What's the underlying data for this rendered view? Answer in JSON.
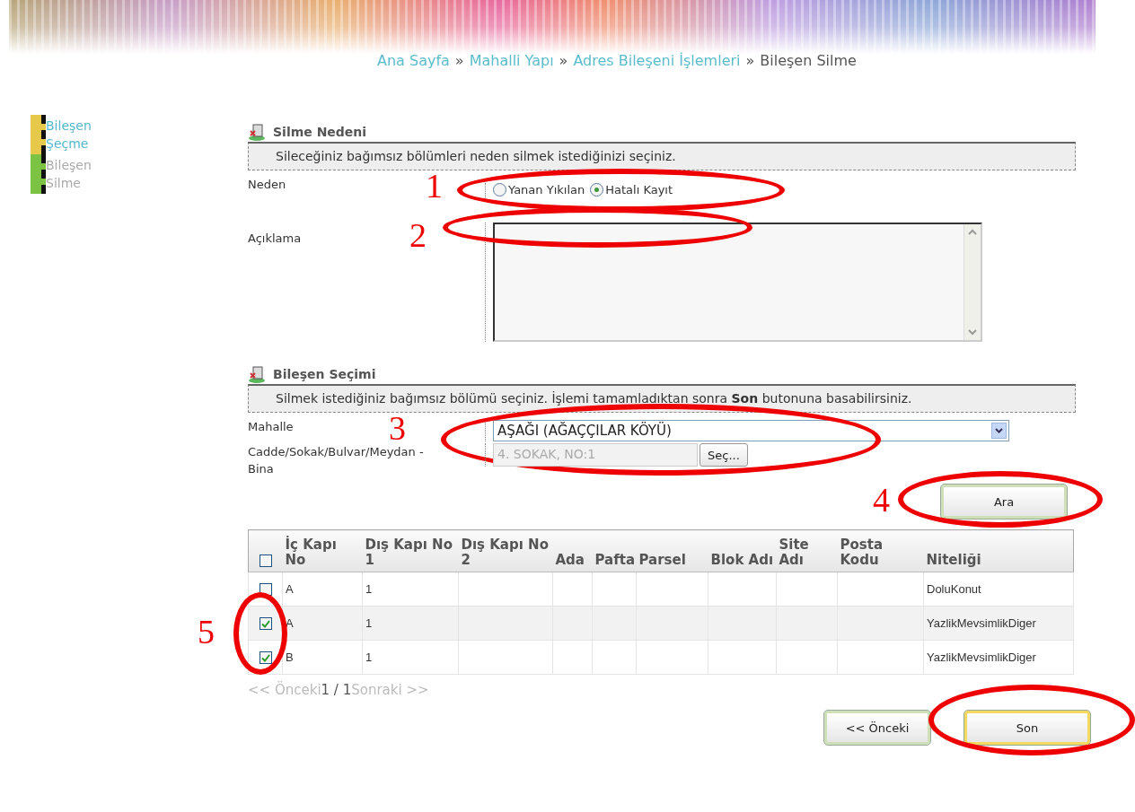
{
  "breadcrumb": [
    {
      "label": "Ana Sayfa",
      "link": true
    },
    {
      "label": "»",
      "link": false
    },
    {
      "label": "Mahalli Yapı",
      "link": true
    },
    {
      "label": "»",
      "link": false
    },
    {
      "label": "Adres Bileşeni İşlemleri",
      "link": true
    },
    {
      "label": "»",
      "link": false
    },
    {
      "label": "Bileşen Silme",
      "link": false
    }
  ],
  "steps": [
    {
      "label": "Bileşen Şeçme",
      "active": true,
      "color": "#e6c84a"
    },
    {
      "label": "Bileşen Silme",
      "active": false,
      "color": "#7cc243"
    }
  ],
  "reason_section": {
    "title": "Silme Nedeni",
    "info": "Sileceğiniz bağımsız bölümleri neden silmek istediğinizi seçiniz.",
    "reason": {
      "label": "Neden",
      "annotation": "1",
      "options": [
        {
          "label": "Yanan Yıkılan",
          "selected": false
        },
        {
          "label": "Hatalı Kayıt",
          "selected": true
        }
      ]
    },
    "description": {
      "label": "Açıklama",
      "annotation": "2"
    }
  },
  "selection_section": {
    "title": "Bileşen Seçimi",
    "info": "Silmek istediğiniz bağımsız bölümü seçiniz. İşlemi tamamladıktan sonra **Son** butonuna basabilirsiniz.",
    "neighborhood": {
      "label": "Mahalle",
      "value": "AŞAĞI (AĞAÇÇILAR KÖYÜ)",
      "annotation": "3"
    },
    "street": {
      "label": "Cadde/Sokak/Bulvar/Meydan - Bina",
      "value": "4. SOKAK, NO:1",
      "disabled": true,
      "button": "Seç..."
    },
    "search_button": {
      "label": "Ara",
      "annotation": "4"
    }
  },
  "table": {
    "select_all": false,
    "annotation": "5",
    "columns": [
      "İç Kapı No",
      "Dış Kapı No 1",
      "Dış Kapı No 2",
      "Ada",
      "Pafta",
      "Parsel",
      "Blok Adı",
      "Site Adı",
      "Posta Kodu",
      "Niteliği"
    ],
    "rows": [
      {
        "checked": false,
        "cells": [
          "A",
          "1",
          "",
          "",
          "",
          "",
          "",
          "",
          "",
          "DoluKonut"
        ]
      },
      {
        "checked": true,
        "cells": [
          "A",
          "1",
          "",
          "",
          "",
          "",
          "",
          "",
          "",
          "YazlikMevsimlikDiger"
        ]
      },
      {
        "checked": true,
        "cells": [
          "B",
          "1",
          "",
          "",
          "",
          "",
          "",
          "",
          "",
          "YazlikMevsimlikDiger"
        ]
      }
    ]
  },
  "pager": {
    "previous": "<< Önceki",
    "page": "1 / 1",
    "next": "Sonraki >>"
  },
  "buttons": [
    {
      "label": "<< Önceki",
      "default": false,
      "circled": false
    },
    {
      "label": "Son",
      "default": true,
      "circled": true
    }
  ]
}
